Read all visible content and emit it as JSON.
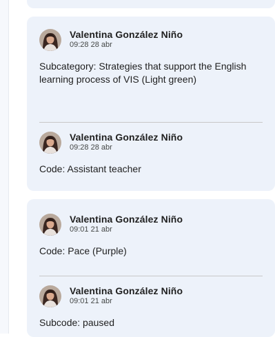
{
  "threads": [
    {
      "comments": [
        {
          "author": "Valentina González Niño",
          "time": "09:28 28 abr",
          "text": "Subcategory: Strategies that support the English learning process of VIS (Light green)"
        },
        {
          "author": "Valentina González Niño",
          "time": "09:28 28 abr",
          "text": "Code: Assistant teacher"
        }
      ]
    },
    {
      "comments": [
        {
          "author": "Valentina González Niño",
          "time": "09:01 21 abr",
          "text": "Code: Pace (Purple)"
        },
        {
          "author": "Valentina González Niño",
          "time": "09:01 21 abr",
          "text": "Subcode: paused"
        }
      ]
    }
  ],
  "colors": {
    "card_background": "#edf2fa",
    "divider": "#c7c7c7"
  },
  "icons": {
    "avatar": "user-photo-avatar"
  }
}
